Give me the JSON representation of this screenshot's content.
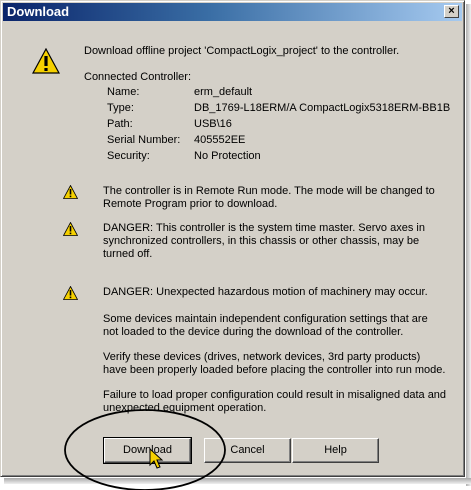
{
  "window": {
    "title": "Download",
    "close_label": "×"
  },
  "intro": "Download offline project 'CompactLogix_project' to the controller.",
  "connected_label": "Connected Controller:",
  "controller": {
    "name_label": "Name:",
    "name": "erm_default",
    "type_label": "Type:",
    "type": "DB_1769-L18ERM/A CompactLogix5318ERM-BB1B",
    "path_label": "Path:",
    "path": "USB\\16",
    "serial_label": "Serial Number:",
    "serial": "405552EE",
    "security_label": "Security:",
    "security": "No Protection"
  },
  "warnings": {
    "w1_line1": "The controller is in Remote Run mode. The mode will be changed to",
    "w1_line2": "Remote Program prior to download.",
    "w2_line1": "DANGER: This controller is the system time master.  Servo axes in",
    "w2_line2": "synchronized controllers, in this chassis or other chassis, may be",
    "w2_line3": "turned off.",
    "w3_line1": "DANGER: Unexpected hazardous motion of machinery may occur."
  },
  "notes": {
    "n1_line1": "Some devices maintain independent configuration settings that are",
    "n1_line2": "not loaded to the device during the download of the controller.",
    "n2_line1": "Verify these devices (drives, network devices, 3rd party products)",
    "n2_line2": "have been properly loaded before placing the controller into run mode.",
    "n3_line1": "Failure to load proper configuration could result in misaligned data and",
    "n3_line2": "unexpected equipment operation."
  },
  "buttons": {
    "download": "Download",
    "cancel": "Cancel",
    "help": "Help"
  },
  "colors": {
    "titlebar_start": "#0a246a",
    "titlebar_end": "#a6caf0",
    "warning_yellow": "#f5d000",
    "dialog_face": "#d4d0c8"
  }
}
